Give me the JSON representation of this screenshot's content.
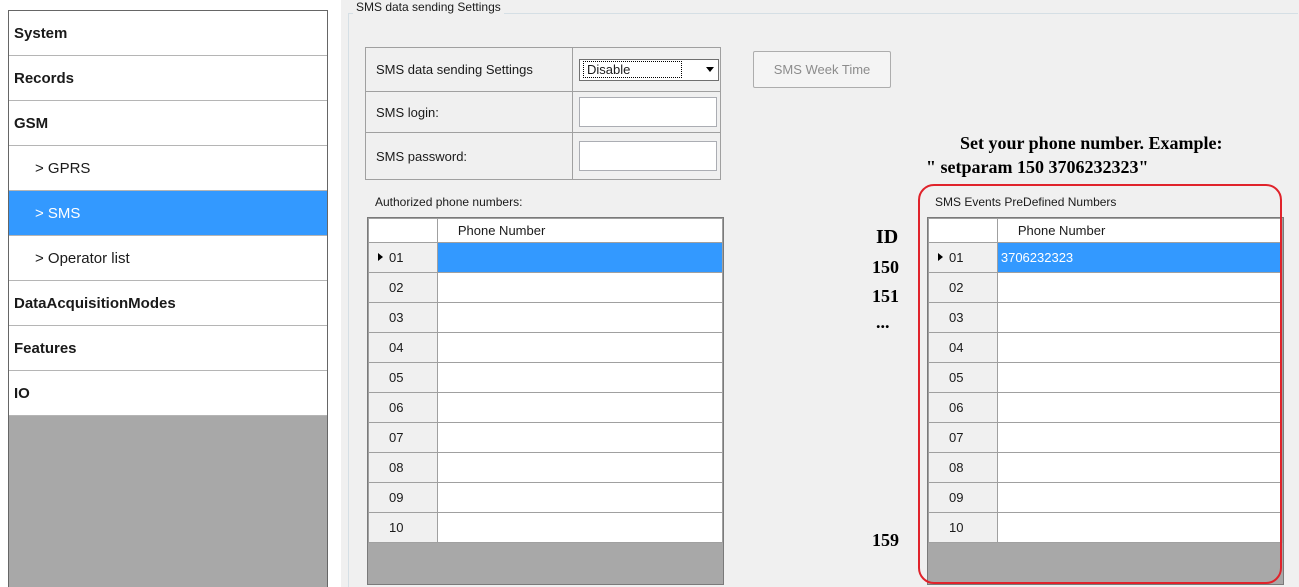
{
  "sidebar": {
    "items": [
      {
        "label": "System",
        "level": "top",
        "selected": false
      },
      {
        "label": "Records",
        "level": "top",
        "selected": false
      },
      {
        "label": "GSM",
        "level": "top",
        "selected": false
      },
      {
        "label": "> GPRS",
        "level": "sub",
        "selected": false
      },
      {
        "label": "> SMS",
        "level": "sub",
        "selected": true
      },
      {
        "label": "> Operator list",
        "level": "sub",
        "selected": false
      },
      {
        "label": "DataAcquisitionModes",
        "level": "top",
        "selected": false
      },
      {
        "label": "Features",
        "level": "top",
        "selected": false
      },
      {
        "label": "IO",
        "level": "top",
        "selected": false
      }
    ]
  },
  "main": {
    "group_title": "SMS data sending Settings",
    "settings": {
      "sending_label": "SMS data sending Settings",
      "sending_value": "Disable",
      "login_label": "SMS login:",
      "login_value": "",
      "password_label": "SMS password:",
      "password_value": ""
    },
    "week_time_button": "SMS Week Time",
    "authorized": {
      "title": "Authorized phone numbers:",
      "column_header": "Phone Number",
      "rows": [
        {
          "id": "01",
          "value": ""
        },
        {
          "id": "02",
          "value": ""
        },
        {
          "id": "03",
          "value": ""
        },
        {
          "id": "04",
          "value": ""
        },
        {
          "id": "05",
          "value": ""
        },
        {
          "id": "06",
          "value": ""
        },
        {
          "id": "07",
          "value": ""
        },
        {
          "id": "08",
          "value": ""
        },
        {
          "id": "09",
          "value": ""
        },
        {
          "id": "10",
          "value": ""
        }
      ]
    },
    "predefined": {
      "title": "SMS Events PreDefined Numbers",
      "column_header": "Phone Number",
      "rows": [
        {
          "id": "01",
          "value": "3706232323"
        },
        {
          "id": "02",
          "value": ""
        },
        {
          "id": "03",
          "value": ""
        },
        {
          "id": "04",
          "value": ""
        },
        {
          "id": "05",
          "value": ""
        },
        {
          "id": "06",
          "value": ""
        },
        {
          "id": "07",
          "value": ""
        },
        {
          "id": "08",
          "value": ""
        },
        {
          "id": "09",
          "value": ""
        },
        {
          "id": "10",
          "value": ""
        }
      ]
    }
  },
  "annotations": {
    "note_line1": "Set your phone number. Example:",
    "note_line2": "\" setparam 150 3706232323\"",
    "id_header": "ID",
    "id_first": "150",
    "id_second": "151",
    "id_ellipsis": "...",
    "id_last": "159",
    "highlight_color": "#e0232b"
  },
  "colors": {
    "selection": "#3399ff",
    "panel_bg": "#f0f0f0",
    "sidebar_empty": "#a8a8a8"
  }
}
